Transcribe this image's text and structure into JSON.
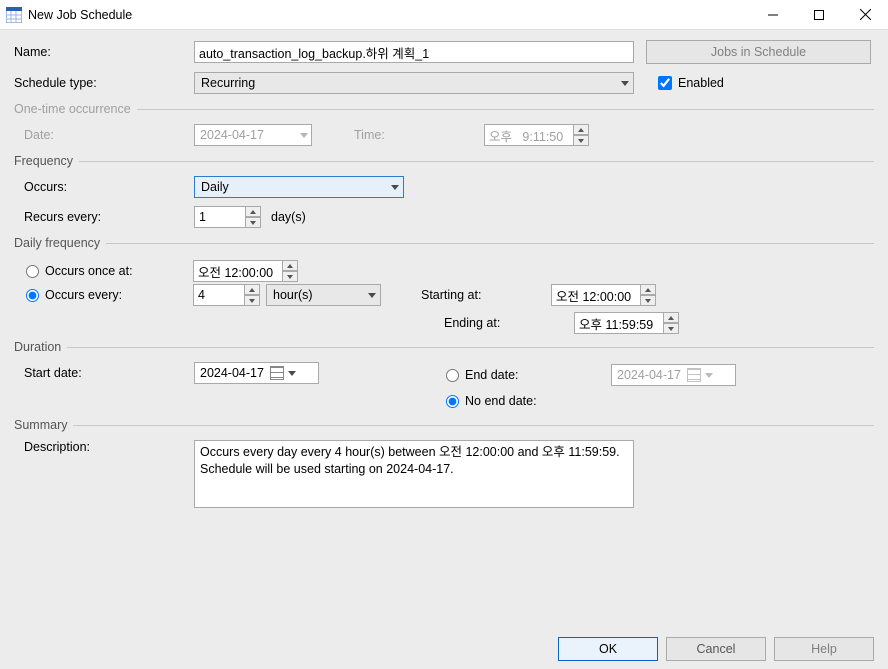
{
  "window": {
    "title": "New Job Schedule"
  },
  "header": {
    "name_label": "Name:",
    "name_value": "auto_transaction_log_backup.하위 계획_1",
    "schedule_type_label": "Schedule type:",
    "schedule_type_value": "Recurring",
    "jobs_button": "Jobs in Schedule",
    "enabled_label": "Enabled"
  },
  "onetime": {
    "group": "One-time occurrence",
    "date_label": "Date:",
    "date_value": "2024-04-17",
    "time_label": "Time:",
    "time_value": "오후   9:11:50"
  },
  "frequency": {
    "group": "Frequency",
    "occurs_label": "Occurs:",
    "occurs_value": "Daily",
    "recurs_label": "Recurs every:",
    "recurs_value": "1",
    "recurs_unit": "day(s)"
  },
  "daily": {
    "group": "Daily frequency",
    "once_label": "Occurs once at:",
    "once_value": "오전 12:00:00",
    "every_label": "Occurs every:",
    "every_value": "4",
    "every_unit": "hour(s)",
    "starting_label": "Starting at:",
    "starting_value": "오전 12:00:00",
    "ending_label": "Ending at:",
    "ending_value": "오후 11:59:59"
  },
  "duration": {
    "group": "Duration",
    "start_label": "Start date:",
    "start_value": "2024-04-17",
    "end_label": "End date:",
    "end_value": "2024-04-17",
    "noend_label": "No end date:"
  },
  "summary": {
    "group": "Summary",
    "desc_label": "Description:",
    "desc_value": "Occurs every day every 4 hour(s) between 오전 12:00:00 and 오후 11:59:59. Schedule will be used starting on 2024-04-17."
  },
  "buttons": {
    "ok": "OK",
    "cancel": "Cancel",
    "help": "Help"
  }
}
